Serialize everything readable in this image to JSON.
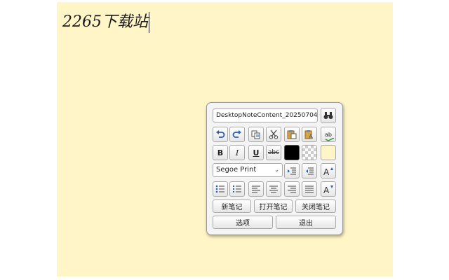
{
  "note": {
    "text": "2265下载站",
    "background": "#fff5c6"
  },
  "toolbar": {
    "filename": "DesktopNoteContent_20250704",
    "font_name": "Segoe Print",
    "bold_label": "B",
    "italic_label": "I",
    "underline_label": "U",
    "strike_label": "abc",
    "spell_label": "ab",
    "font_color": "#000000",
    "note_color": "#fff5c6"
  },
  "buttons": {
    "new_note": "新笔记",
    "open_note": "打开笔记",
    "close_note": "关闭笔记",
    "options": "选项",
    "exit": "退出"
  },
  "icons": [
    "search-binoculars-icon",
    "undo-icon",
    "redo-icon",
    "copy-icon",
    "cut-icon",
    "paste-icon",
    "paste-format-icon",
    "spellcheck-icon",
    "indent-increase-icon",
    "indent-decrease-icon",
    "font-grow-icon",
    "bullet-list-icon",
    "numbered-list-icon",
    "align-left-icon",
    "align-center-icon",
    "align-right-icon",
    "align-justify-icon",
    "font-shrink-icon"
  ]
}
